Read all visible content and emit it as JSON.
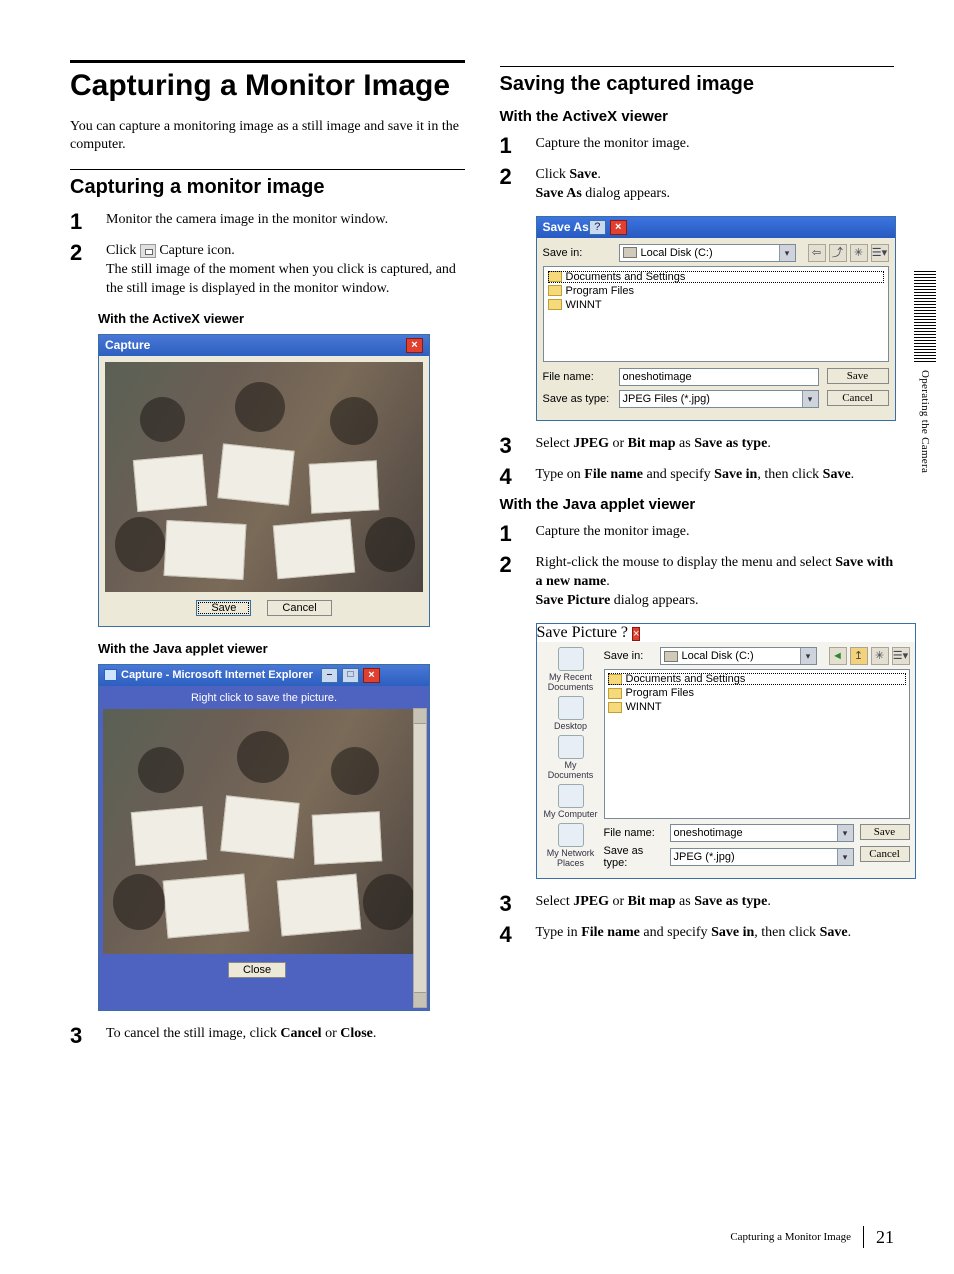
{
  "page": {
    "number": "21",
    "footer_title": "Capturing a Monitor Image",
    "side_tab": "Operating the Camera"
  },
  "left": {
    "h1": "Capturing a Monitor Image",
    "intro": "You can capture a monitoring image as a still image and save it in the computer.",
    "h2": "Capturing a monitor image",
    "steps": {
      "s1": "Monitor the camera image in the monitor window.",
      "s2a": "Click ",
      "s2b": " Capture icon.",
      "s2c": "The still image of the moment when you click is captured, and the still image is displayed in the monitor window.",
      "s3a": "To cancel the still image, click ",
      "s3b": "Cancel",
      "s3c": " or ",
      "s3d": "Close",
      "s3e": "."
    },
    "h4a": "With the ActiveX viewer",
    "h4b": "With the Java applet viewer",
    "capwin": {
      "title": "Capture",
      "save": "Save",
      "cancel": "Cancel"
    },
    "javawin": {
      "title": "Capture - Microsoft Internet Explorer",
      "hint": "Right click to save the picture.",
      "close": "Close"
    }
  },
  "right": {
    "h2": "Saving the captured image",
    "h3a": "With the ActiveX viewer",
    "ax": {
      "s1": "Capture the monitor image.",
      "s2a": "Click ",
      "s2b": "Save",
      "s2c": ".",
      "s2d": "Save As",
      "s2e": " dialog appears.",
      "s3a": "Select ",
      "s3b": "JPEG",
      "s3c": " or ",
      "s3d": "Bit map",
      "s3e": " as ",
      "s3f": "Save as type",
      "s3g": ".",
      "s4a": "Type on ",
      "s4b": "File name",
      "s4c": " and specify ",
      "s4d": "Save in",
      "s4e": ", then click ",
      "s4f": "Save",
      "s4g": "."
    },
    "h3b": "With the Java applet viewer",
    "jv": {
      "s1": "Capture the monitor image.",
      "s2a": "Right-click the mouse to display the menu and select ",
      "s2b": "Save with a new name",
      "s2c": ".",
      "s2d": "Save Picture",
      "s2e": " dialog appears.",
      "s3a": "Select ",
      "s3b": "JPEG",
      "s3c": " or ",
      "s3d": "Bit map",
      "s3e": " as ",
      "s3f": "Save as type",
      "s3g": ".",
      "s4a": "Type in ",
      "s4b": "File name",
      "s4c": " and specify ",
      "s4d": "Save in",
      "s4e": ", then click ",
      "s4f": "Save",
      "s4g": "."
    },
    "saveas": {
      "title": "Save As",
      "savein_label": "Save in:",
      "savein_value": "Local Disk (C:)",
      "folders": {
        "a": "Documents and Settings",
        "b": "Program Files",
        "c": "WINNT"
      },
      "filename_label": "File name:",
      "filename_value": "oneshotimage",
      "type_label": "Save as type:",
      "type_value": "JPEG Files (*.jpg)",
      "save_btn": "Save",
      "cancel_btn": "Cancel"
    },
    "savepic": {
      "title": "Save Picture",
      "savein_label": "Save in:",
      "savein_value": "Local Disk (C:)",
      "places": {
        "a": "My Recent Documents",
        "b": "Desktop",
        "c": "My Documents",
        "d": "My Computer",
        "e": "My Network Places"
      },
      "folders": {
        "a": "Documents and Settings",
        "b": "Program Files",
        "c": "WINNT"
      },
      "filename_label": "File name:",
      "filename_value": "oneshotimage",
      "type_label": "Save as type:",
      "type_value": "JPEG (*.jpg)",
      "save_btn": "Save",
      "cancel_btn": "Cancel"
    }
  }
}
